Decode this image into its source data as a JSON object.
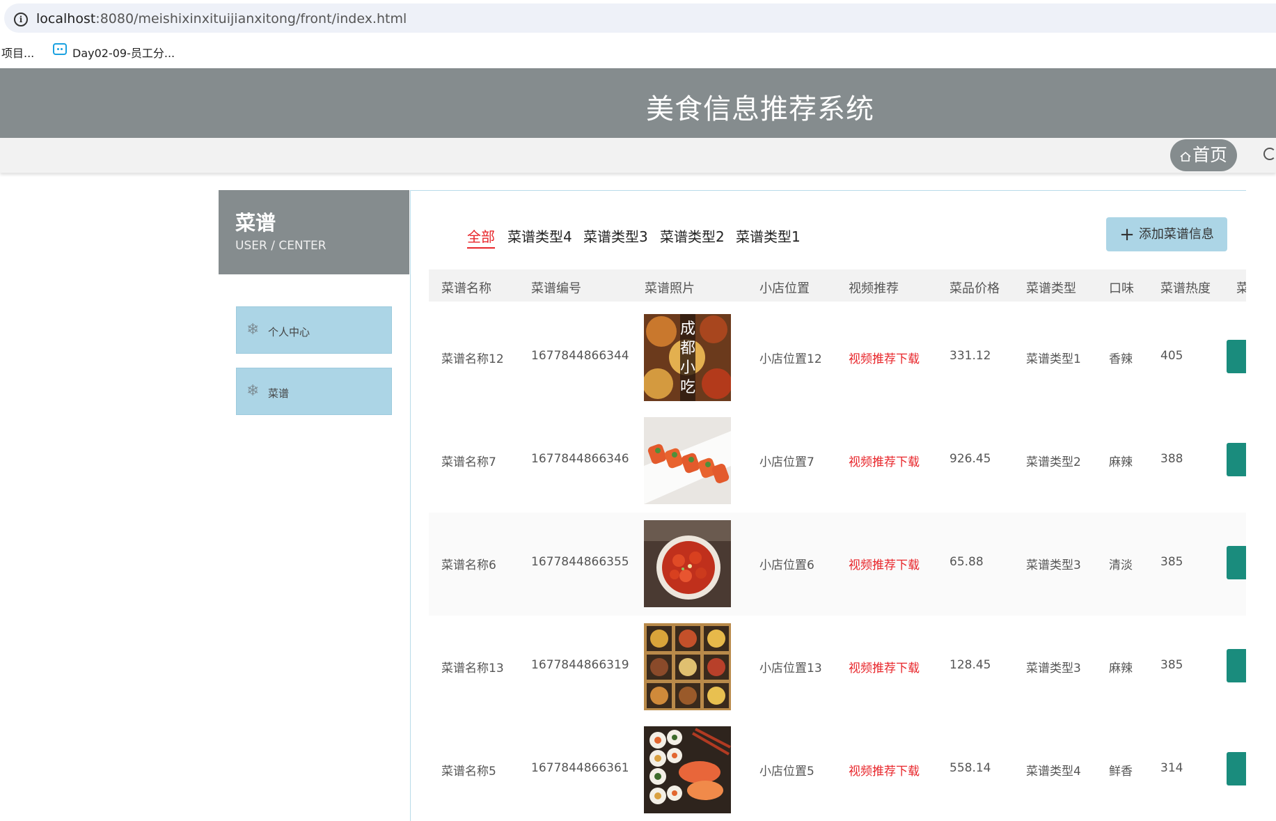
{
  "browser": {
    "url_host": "localhost",
    "url_rest": ":8080/meishixinxituijianxitong/front/index.html",
    "bookmarks": [
      "项目...",
      "Day02-09-员工分..."
    ]
  },
  "site": {
    "title": "美食信息推荐系统",
    "nav_home": "首页"
  },
  "sidebar": {
    "title": "菜谱",
    "subtitle": "USER / CENTER",
    "items": [
      {
        "label": "个人中心"
      },
      {
        "label": "菜谱"
      }
    ]
  },
  "filters": [
    "全部",
    "菜谱类型4",
    "菜谱类型3",
    "菜谱类型2",
    "菜谱类型1"
  ],
  "active_filter": "全部",
  "add_button": "添加菜谱信息",
  "table": {
    "headers": [
      "菜谱名称",
      "菜谱编号",
      "菜谱照片",
      "小店位置",
      "视频推荐",
      "菜品价格",
      "菜谱类型",
      "口味",
      "菜谱热度",
      "菜"
    ],
    "rows": [
      {
        "name": "菜谱名称12",
        "code": "1677844866344",
        "photo": "food-photo-chengdu-snacks",
        "location": "小店位置12",
        "video": "视频推荐下载",
        "price": "331.12",
        "type": "菜谱类型1",
        "taste": "香辣",
        "heat": "405"
      },
      {
        "name": "菜谱名称7",
        "code": "1677844866346",
        "photo": "food-photo-sushi-rolls",
        "location": "小店位置7",
        "video": "视频推荐下载",
        "price": "926.45",
        "type": "菜谱类型2",
        "taste": "麻辣",
        "heat": "388"
      },
      {
        "name": "菜谱名称6",
        "code": "1677844866355",
        "photo": "food-photo-crayfish-bowl",
        "location": "小店位置6",
        "video": "视频推荐下载",
        "price": "65.88",
        "type": "菜谱类型3",
        "taste": "清淡",
        "heat": "385"
      },
      {
        "name": "菜谱名称13",
        "code": "1677844866319",
        "photo": "food-photo-grid-platter",
        "location": "小店位置13",
        "video": "视频推荐下载",
        "price": "128.45",
        "type": "菜谱类型3",
        "taste": "麻辣",
        "heat": "385"
      },
      {
        "name": "菜谱名称5",
        "code": "1677844866361",
        "photo": "food-photo-sushi-platter",
        "location": "小店位置5",
        "video": "视频推荐下载",
        "price": "558.14",
        "type": "菜谱类型4",
        "taste": "鲜香",
        "heat": "314"
      }
    ]
  },
  "photo_overlay_text": "成都小吃",
  "colors": {
    "header_bg": "#858c8e",
    "accent_red": "#e8252a",
    "side_item_bg": "#acd5e6",
    "action_teal": "#1a8c7d"
  }
}
